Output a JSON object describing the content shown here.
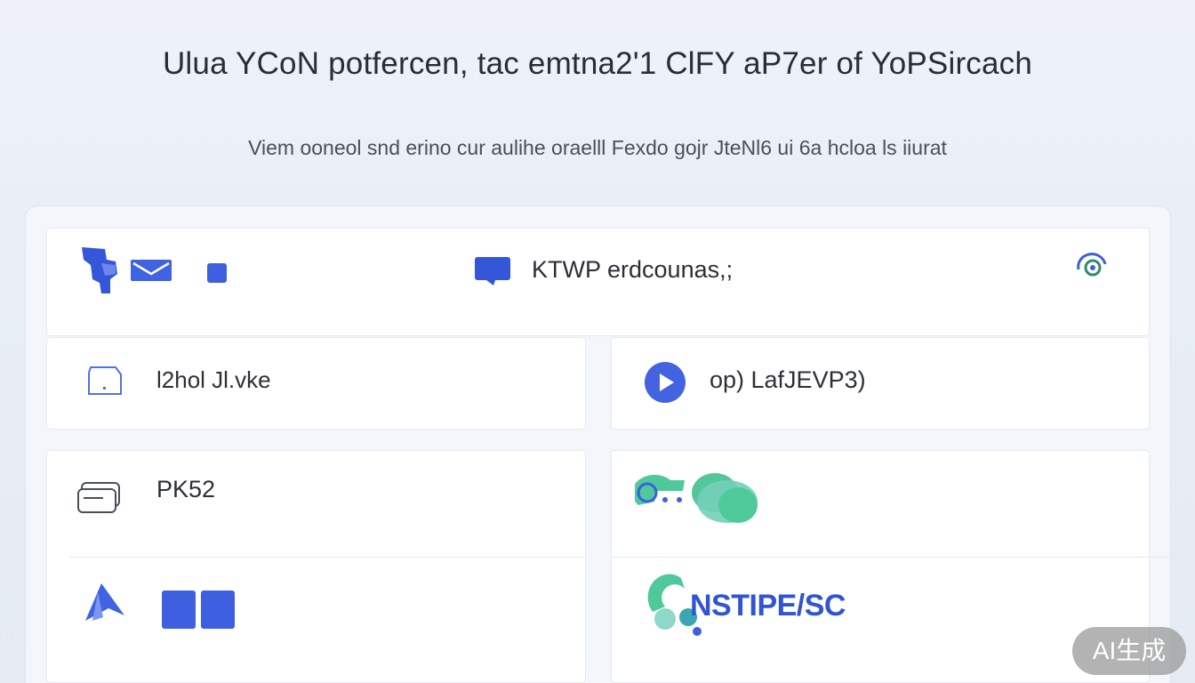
{
  "header": {
    "title": "Ulua YCoN potfercen, tac emtna2'1 ClFY aP7er of YoPSircach",
    "subtitle": "Viem ooneol snd erino cur aulihe oraelll Fexdo gojr JteNl6 ui 6a hcloa ls iiurat"
  },
  "topbar": {
    "title": "KTWP erdcounas,;",
    "icons": [
      "brand-logo-icon",
      "mail-icon",
      "square-icon",
      "chat-bubble-icon",
      "target-icon"
    ]
  },
  "rows": [
    {
      "label": "l2hol Jl.vke",
      "icon": "folder-icon"
    },
    {
      "label": "op) LafJEVP3)",
      "icon": "play-icon"
    },
    {
      "label": "PK52",
      "icon": "card-stack-icon"
    }
  ],
  "brand": {
    "text": "NSTIPE/SC"
  },
  "badge": {
    "label": "AI生成"
  },
  "colors": {
    "accent": "#3d5fe0",
    "green": "#4fc89a",
    "teal": "#3aa7b0"
  }
}
